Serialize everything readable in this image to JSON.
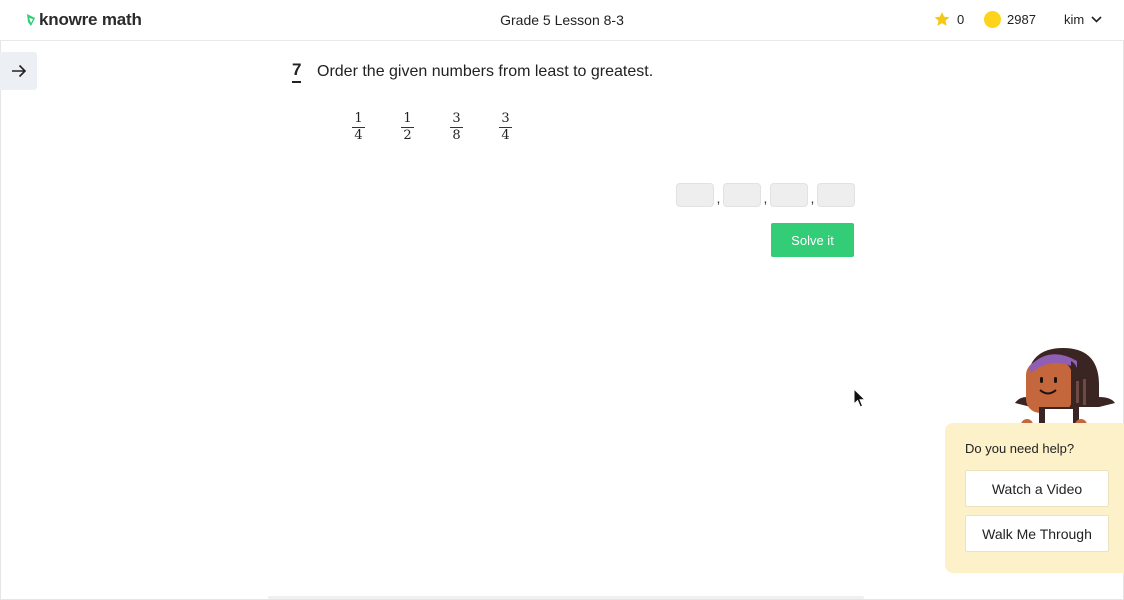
{
  "app": {
    "logo_text": "knowre math",
    "brand_color": "#33cc77"
  },
  "header": {
    "lesson_title": "Grade 5 Lesson 8-3",
    "stars": "0",
    "coins": "2987",
    "user_name": "kim"
  },
  "question": {
    "number": "7",
    "prompt": "Order the given numbers from least to greatest.",
    "fractions": [
      {
        "numerator": "1",
        "denominator": "4"
      },
      {
        "numerator": "1",
        "denominator": "2"
      },
      {
        "numerator": "3",
        "denominator": "8"
      },
      {
        "numerator": "3",
        "denominator": "4"
      }
    ],
    "answer_separator": ",",
    "answer_values": [
      "",
      "",
      "",
      ""
    ]
  },
  "actions": {
    "solve_label": "Solve it"
  },
  "help": {
    "title": "Do you need help?",
    "watch_video_label": "Watch a Video",
    "walk_through_label": "Walk Me Through"
  },
  "icons": {
    "logo": "knowre-leaf-icon",
    "star": "star-icon",
    "coin": "coin-icon",
    "user_menu": "chevron-down-icon",
    "side_toggle": "arrow-right-icon",
    "cursor": "mouse-pointer-icon",
    "mascot": "helper-character-icon"
  },
  "colors": {
    "star": "#f7c812",
    "coin": "#fdd31c",
    "help_panel_bg": "#fdf1c9",
    "answer_box_bg": "#eeeeee"
  }
}
